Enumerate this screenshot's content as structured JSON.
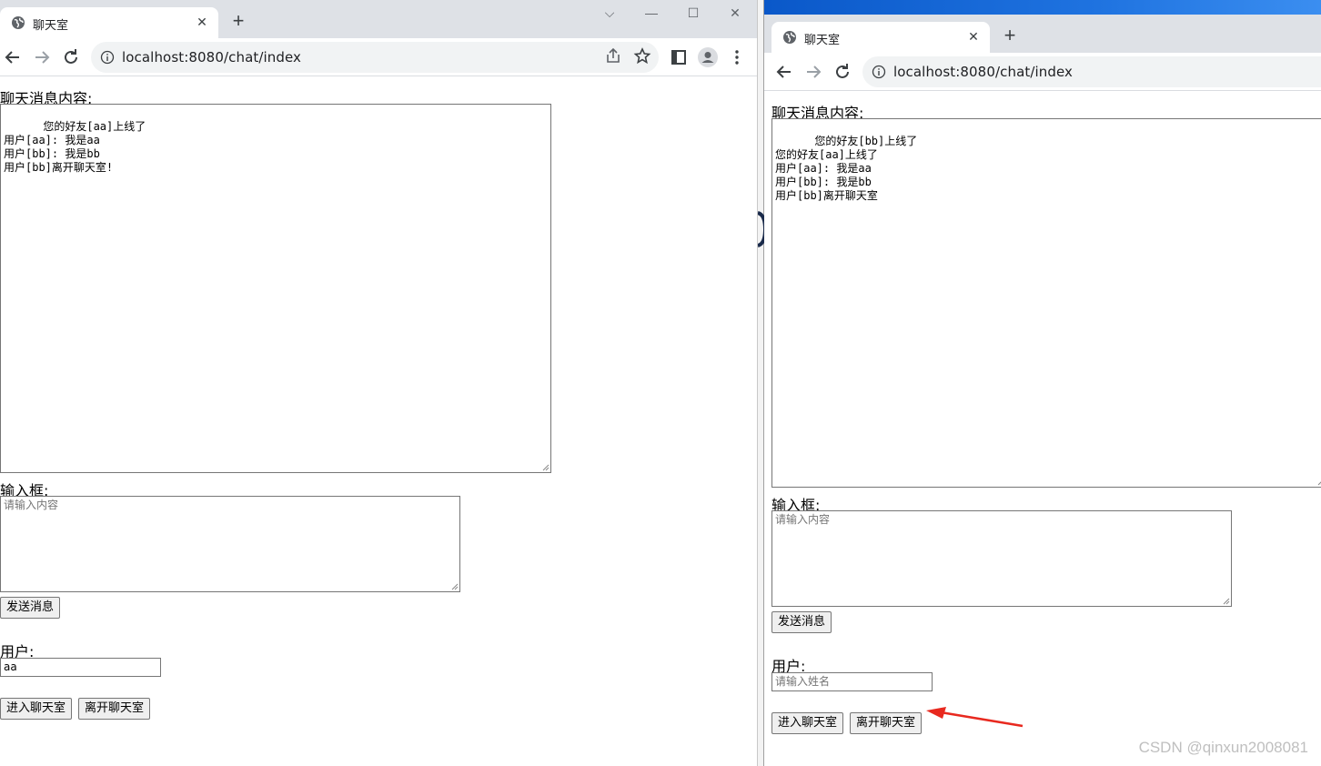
{
  "left_window": {
    "tab_title": "聊天室",
    "url": "localhost:8080/chat/index",
    "messages_label": "聊天消息内容:",
    "messages_text": "您的好友[aa]上线了\n用户[aa]: 我是aa\n用户[bb]: 我是bb\n用户[bb]离开聊天室!",
    "input_label": "输入框:",
    "input_placeholder": "请输入内容",
    "send_label": "发送消息",
    "user_label": "用户:",
    "user_value": "aa",
    "enter_label": "进入聊天室",
    "leave_label": "离开聊天室"
  },
  "right_window": {
    "tab_title": "聊天室",
    "url": "localhost:8080/chat/index",
    "messages_label": "聊天消息内容:",
    "messages_text": "您的好友[bb]上线了\n您的好友[aa]上线了\n用户[aa]: 我是aa\n用户[bb]: 我是bb\n用户[bb]离开聊天室",
    "input_label": "输入框:",
    "input_placeholder": "请输入内容",
    "send_label": "发送消息",
    "user_label": "用户:",
    "user_placeholder": "请输入姓名",
    "enter_label": "进入聊天室",
    "leave_label": "离开聊天室"
  },
  "watermark": "CSDN @qinxun2008081",
  "colors": {
    "arrow": "#e8291f",
    "tabstrip": "#dee1e6",
    "omnibox": "#f1f3f4"
  }
}
